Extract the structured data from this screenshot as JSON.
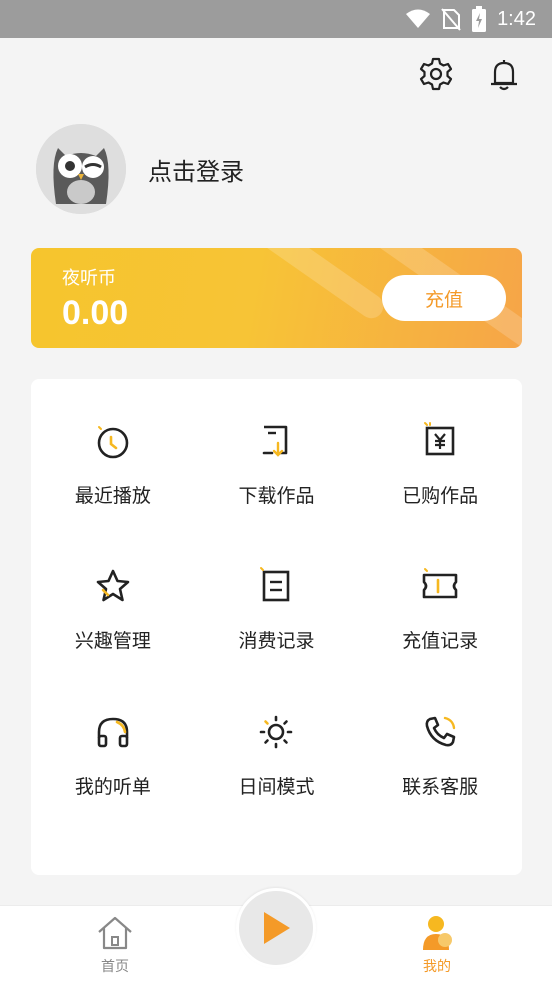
{
  "status_bar": {
    "time": "1:42"
  },
  "profile": {
    "login_text": "点击登录"
  },
  "coin_card": {
    "title": "夜听币",
    "balance": "0.00",
    "recharge_label": "充值"
  },
  "menu": [
    {
      "label": "最近播放",
      "icon": "clock-icon"
    },
    {
      "label": "下载作品",
      "icon": "download-icon"
    },
    {
      "label": "已购作品",
      "icon": "yen-receipt-icon"
    },
    {
      "label": "兴趣管理",
      "icon": "star-icon"
    },
    {
      "label": "消费记录",
      "icon": "list-document-icon"
    },
    {
      "label": "充值记录",
      "icon": "ticket-icon"
    },
    {
      "label": "我的听单",
      "icon": "headphones-icon"
    },
    {
      "label": "日间模式",
      "icon": "sun-icon"
    },
    {
      "label": "联系客服",
      "icon": "phone-icon"
    }
  ],
  "bottom_nav": {
    "home_label": "首页",
    "mine_label": "我的",
    "active": "我的"
  },
  "colors": {
    "accent": "#f49a28",
    "yellow": "#f6c52d",
    "status_bar": "#9c9c9c"
  }
}
